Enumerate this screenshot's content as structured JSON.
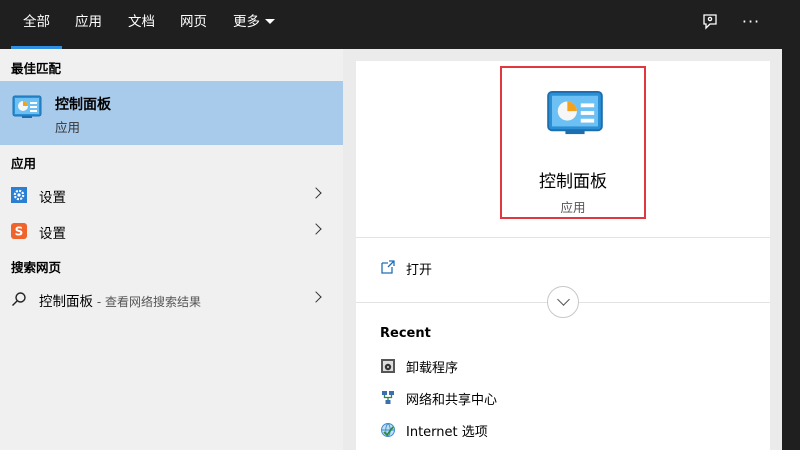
{
  "topbar": {
    "tabs": [
      {
        "label": "全部",
        "active": true
      },
      {
        "label": "应用"
      },
      {
        "label": "文档"
      },
      {
        "label": "网页"
      },
      {
        "label": "更多"
      }
    ],
    "icons": [
      "feedback-icon",
      "more-options-icon"
    ],
    "accent_color": "#2f8ee0"
  },
  "left": {
    "best_match_heading": "最佳匹配",
    "best_match": {
      "title": "控制面板",
      "subtitle": "应用",
      "icon": "control-panel-icon"
    },
    "apps_heading": "应用",
    "apps": [
      {
        "label": "设置",
        "icon": "settings-gear-icon"
      },
      {
        "label": "设置",
        "icon": "sogou-settings-icon"
      }
    ],
    "web_heading": "搜索网页",
    "web_item": {
      "label": "控制面板",
      "suffix": " - 查看网络搜索结果",
      "icon": "search-icon"
    }
  },
  "right": {
    "hero": {
      "title": "控制面板",
      "subtitle": "应用",
      "icon": "control-panel-icon"
    },
    "open_label": "打开",
    "recent_heading": "Recent",
    "recent": [
      {
        "label": "卸载程序",
        "icon": "uninstall-icon"
      },
      {
        "label": "网络和共享中心",
        "icon": "network-icon"
      },
      {
        "label": "Internet 选项",
        "icon": "internet-options-icon"
      }
    ]
  },
  "colors": {
    "selection": "#a9cbeb",
    "highlight_border": "#e0383e",
    "topbar": "#1f1f1f"
  }
}
